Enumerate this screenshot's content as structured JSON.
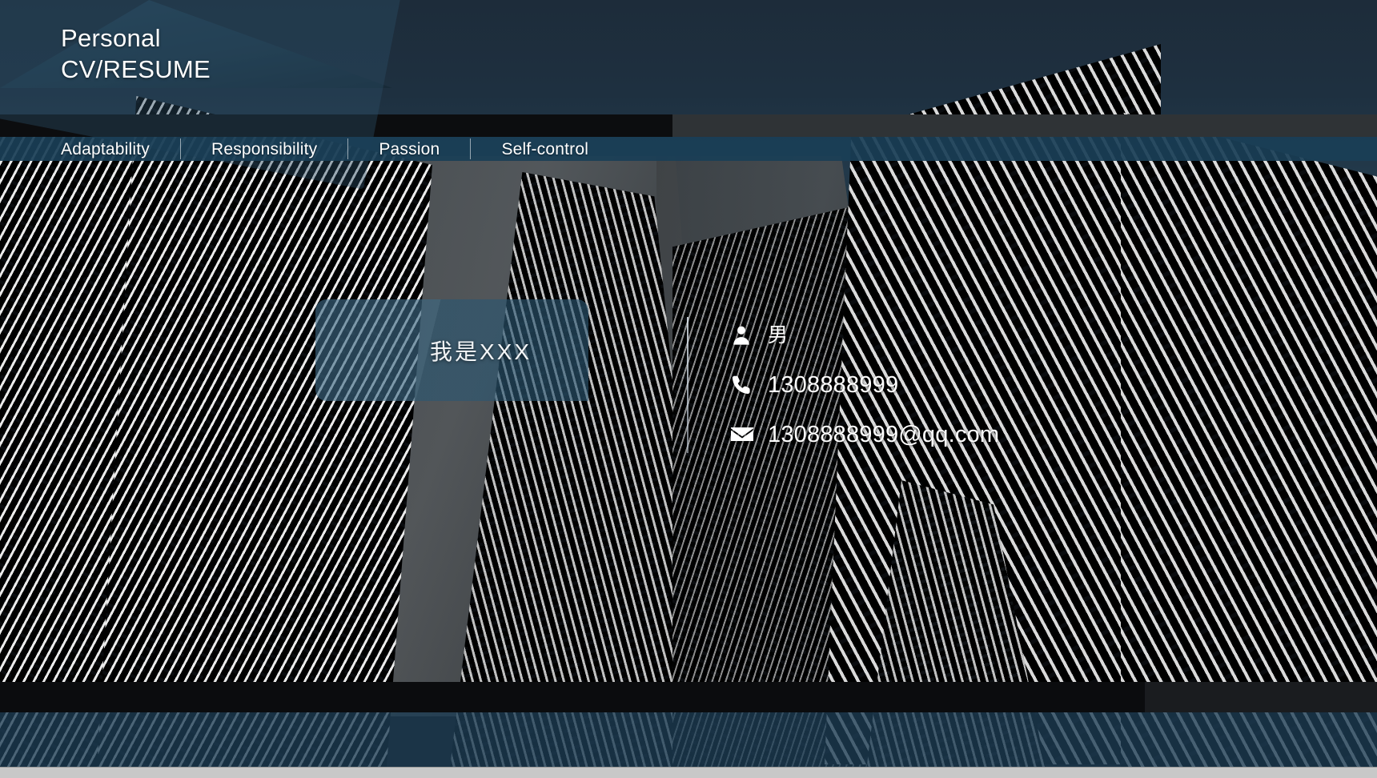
{
  "header": {
    "title_line1": "Personal",
    "title_line2": "CV/RESUME"
  },
  "nav": {
    "items": [
      {
        "label": "Adaptability"
      },
      {
        "label": "Responsibility"
      },
      {
        "label": "Passion"
      },
      {
        "label": "Self-control"
      }
    ]
  },
  "name_card": {
    "name": "我是XXX"
  },
  "contact": {
    "items": [
      {
        "icon": "person-icon",
        "value": "男"
      },
      {
        "icon": "phone-icon",
        "value": "1308888999"
      },
      {
        "icon": "envelope-icon",
        "value": "1308888999@qq.com"
      }
    ]
  },
  "colors": {
    "nav_bar": "#1a3e56",
    "name_card": "#2f5d7b",
    "bottom_band": "#1e3e55",
    "text": "#ffffff",
    "sky": "#1e3040"
  }
}
